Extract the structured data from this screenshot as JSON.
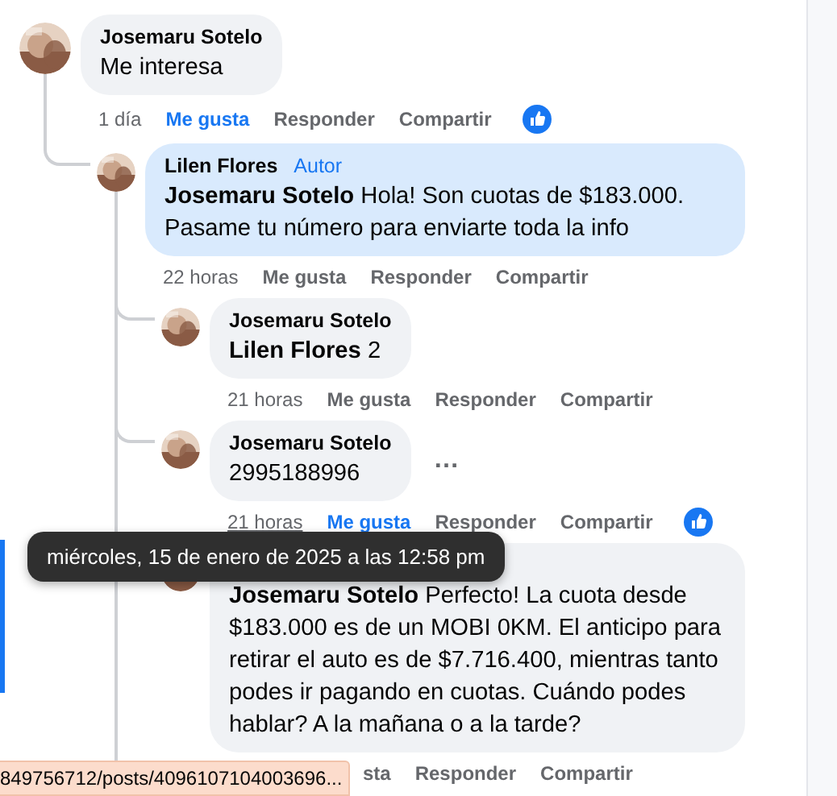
{
  "comments": [
    {
      "author": "Josemaru Sotelo",
      "text": "Me interesa",
      "highlighted": false,
      "actions": [
        {
          "kind": "time",
          "label": "1 día",
          "hovered": false
        },
        {
          "kind": "like",
          "label": "Me gusta",
          "selected": true
        },
        {
          "kind": "reply",
          "label": "Responder"
        },
        {
          "kind": "share",
          "label": "Compartir"
        }
      ],
      "reacted": true,
      "children": [
        {
          "author": "Lilen Flores",
          "badge": "Autor",
          "text": "**Josemaru Sotelo** Hola! Son cuotas de $183.000. Pasame tu número para enviarte toda la info",
          "highlighted": true,
          "actions": [
            {
              "kind": "time",
              "label": "22 horas",
              "hovered": false
            },
            {
              "kind": "like",
              "label": "Me gusta",
              "selected": false
            },
            {
              "kind": "reply",
              "label": "Responder"
            },
            {
              "kind": "share",
              "label": "Compartir"
            }
          ],
          "reacted": false,
          "children": [
            {
              "author": "Josemaru Sotelo",
              "text": "**Lilen Flores** 2",
              "highlighted": false,
              "actions": [
                {
                  "kind": "time",
                  "label": "21 horas",
                  "hovered": false
                },
                {
                  "kind": "like",
                  "label": "Me gusta",
                  "selected": false
                },
                {
                  "kind": "reply",
                  "label": "Responder"
                },
                {
                  "kind": "share",
                  "label": "Compartir"
                }
              ],
              "reacted": false
            },
            {
              "author": "Josemaru Sotelo",
              "text": "2995188996",
              "highlighted": false,
              "more": "…",
              "actions": [
                {
                  "kind": "time",
                  "label": "21 horas",
                  "hovered": true
                },
                {
                  "kind": "like",
                  "label": "Me gusta",
                  "selected": true
                },
                {
                  "kind": "reply",
                  "label": "Responder"
                },
                {
                  "kind": "share",
                  "label": "Compartir"
                }
              ],
              "reacted": true
            },
            {
              "text": "**Josemaru Sotelo** Perfecto! La cuota desde $183.000 es de un MOBI 0KM. El anticipo para retirar el auto es de $7.716.400, mientras tanto podes ir pagando en cuotas. Cuándo podes hablar? A la mañana o a la tarde?",
              "highlighted": false,
              "actions_cut": true,
              "actions": [
                {
                  "kind": "like",
                  "label": "sta",
                  "selected": false
                },
                {
                  "kind": "reply",
                  "label": "Responder"
                },
                {
                  "kind": "share",
                  "label": "Compartir"
                }
              ],
              "reacted": false
            }
          ]
        }
      ]
    }
  ],
  "tooltip": "miércoles, 15 de enero de 2025 a las 12:58 pm",
  "status_bar": "849756712/posts/4096107104003696..."
}
